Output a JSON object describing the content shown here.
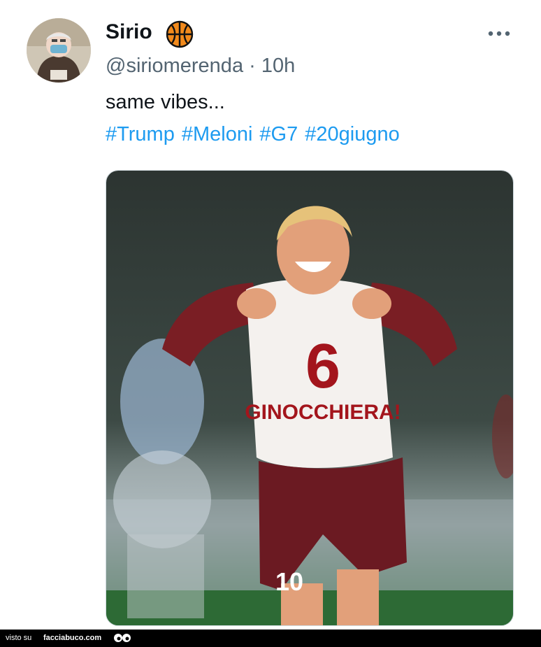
{
  "tweet": {
    "display_name": "Sirio",
    "badge_icon": "basketball-icon",
    "handle": "@siriomerenda",
    "separator": "·",
    "time": "10h",
    "text": "same vibes...",
    "hashtags": [
      "#Trump",
      "#Meloni",
      "#G7",
      "#20giugno"
    ],
    "accent_color": "#1d9bf0"
  },
  "media": {
    "shirt_number": "6",
    "shirt_text": "GINOCCHIERA!",
    "shorts_number": "10"
  },
  "footer": {
    "label": "visto su",
    "site": "facciabuco.com"
  }
}
